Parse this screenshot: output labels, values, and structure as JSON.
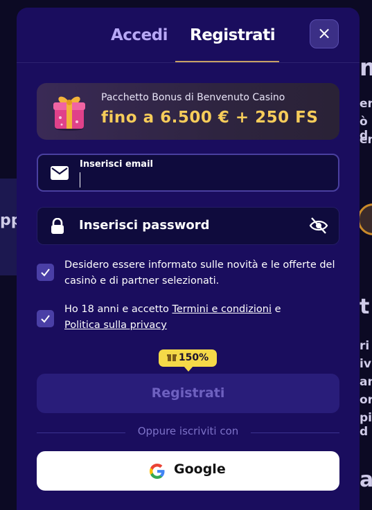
{
  "background": {
    "left_fragment": "ppi",
    "right_fragments": [
      "m",
      "en",
      "ò d",
      "eno",
      "t",
      "ri",
      "ivit",
      "an",
      "orio",
      "pi d",
      "a"
    ]
  },
  "tabs": [
    {
      "label": "Accedi",
      "active": false
    },
    {
      "label": "Registrati",
      "active": true
    }
  ],
  "close_label": "×",
  "bonus": {
    "title": "Pacchetto Bonus di Benvenuto Casino",
    "amount": "fino a 6.500 € + 250 FS",
    "icon": "gift-icon"
  },
  "email_field": {
    "label": "Inserisci email",
    "value": "",
    "icon": "envelope-icon"
  },
  "password_field": {
    "placeholder": "Inserisci password",
    "icon": "lock-icon",
    "toggle_icon": "eye-off-icon"
  },
  "consents": [
    {
      "checked": true,
      "text": "Desidero essere informato sulle novità e le offerte del casinò e di partner selezionati."
    },
    {
      "checked": true,
      "prefix": "Ho 18 anni e accetto ",
      "link1": "Termini e condizioni",
      "middle": " e ",
      "link2": "Politica sulla privacy"
    }
  ],
  "badge": {
    "text": "150%",
    "icon": "gift-icon"
  },
  "register_button": "Registrati",
  "divider_text": "Oppure iscriviti con",
  "google_button": "Google",
  "colors": {
    "modal_bg": "#1a0d5e",
    "accent_gold": "#f6cc5a",
    "badge_yellow": "#f5d948",
    "checkbox": "#4a3fa6"
  }
}
